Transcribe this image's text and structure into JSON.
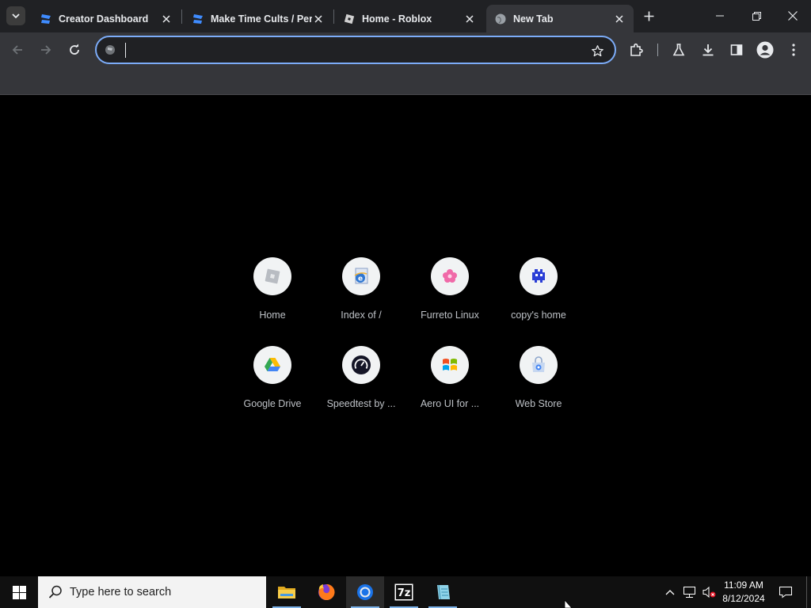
{
  "browser": {
    "tabs": [
      {
        "title": "Creator Dashboard",
        "icon": "roblox-studio-icon",
        "active": false
      },
      {
        "title": "Make Time Cults / Per",
        "icon": "roblox-studio-icon",
        "active": false
      },
      {
        "title": "Home - Roblox",
        "icon": "roblox-icon",
        "active": false
      },
      {
        "title": "New Tab",
        "icon": "globe-icon",
        "active": true
      }
    ],
    "omnibox": {
      "value": "",
      "placeholder": ""
    }
  },
  "shortcuts": [
    {
      "label": "Home",
      "icon": "roblox-tilt-icon"
    },
    {
      "label": "Index of /",
      "icon": "internet-explorer-icon"
    },
    {
      "label": "Furreto Linux",
      "icon": "pink-flower-icon"
    },
    {
      "label": "copy's home",
      "icon": "pixel-creature-icon"
    },
    {
      "label": "Google Drive",
      "icon": "google-drive-icon"
    },
    {
      "label": "Speedtest by ...",
      "icon": "speedtest-icon"
    },
    {
      "label": "Aero UI for ...",
      "icon": "windows-flag-icon"
    },
    {
      "label": "Web Store",
      "icon": "web-store-icon"
    }
  ],
  "taskbar": {
    "search_placeholder": "Type here to search",
    "apps": [
      "file-explorer-icon",
      "firefox-icon",
      "chrome-icon",
      "7zip-icon",
      "notepad-icon"
    ],
    "time": "11:09 AM",
    "date": "8/12/2024"
  },
  "colors": {
    "accent": "#7cacf8",
    "tab_strip": "#202124",
    "toolbar": "#35363a",
    "page_bg": "#000000"
  }
}
